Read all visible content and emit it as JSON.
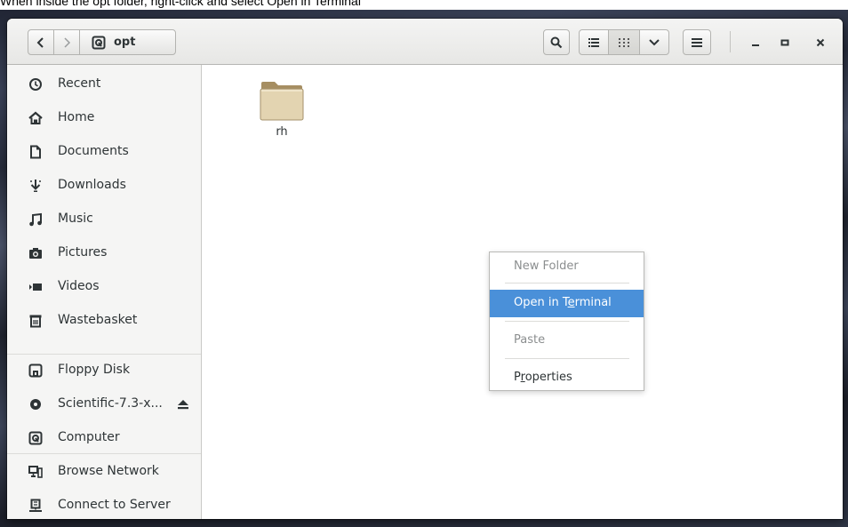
{
  "caption": {
    "text": "When inside the opt folder, right-click and select Open in Terminal"
  },
  "header": {
    "path_label": "opt"
  },
  "sidebar": {
    "items": [
      {
        "label": "Recent",
        "icon": "clock-icon"
      },
      {
        "label": "Home",
        "icon": "home-icon"
      },
      {
        "label": "Documents",
        "icon": "document-icon"
      },
      {
        "label": "Downloads",
        "icon": "download-icon"
      },
      {
        "label": "Music",
        "icon": "music-icon"
      },
      {
        "label": "Pictures",
        "icon": "camera-icon"
      },
      {
        "label": "Videos",
        "icon": "video-icon"
      },
      {
        "label": "Wastebasket",
        "icon": "trash-icon"
      },
      {
        "label": "Floppy Disk",
        "icon": "floppy-icon"
      },
      {
        "label": "Scientific-7.3-x...",
        "icon": "disc-icon",
        "eject": "eject-icon"
      },
      {
        "label": "Computer",
        "icon": "computer-icon"
      },
      {
        "label": "Browse Network",
        "icon": "network-icon"
      },
      {
        "label": "Connect to Server",
        "icon": "server-icon"
      }
    ]
  },
  "content": {
    "folders": [
      {
        "name": "rh"
      }
    ]
  },
  "context_menu": {
    "new_folder": "New Folder",
    "open_terminal_pre": "Open in T",
    "open_terminal_mn": "e",
    "open_terminal_post": "rminal",
    "paste": "Paste",
    "properties_pre": "P",
    "properties_mn": "r",
    "properties_post": "operties"
  },
  "colors": {
    "selection": "#4a90d9",
    "folder_body": "#e3d4b1",
    "folder_tab": "#a68e62"
  }
}
